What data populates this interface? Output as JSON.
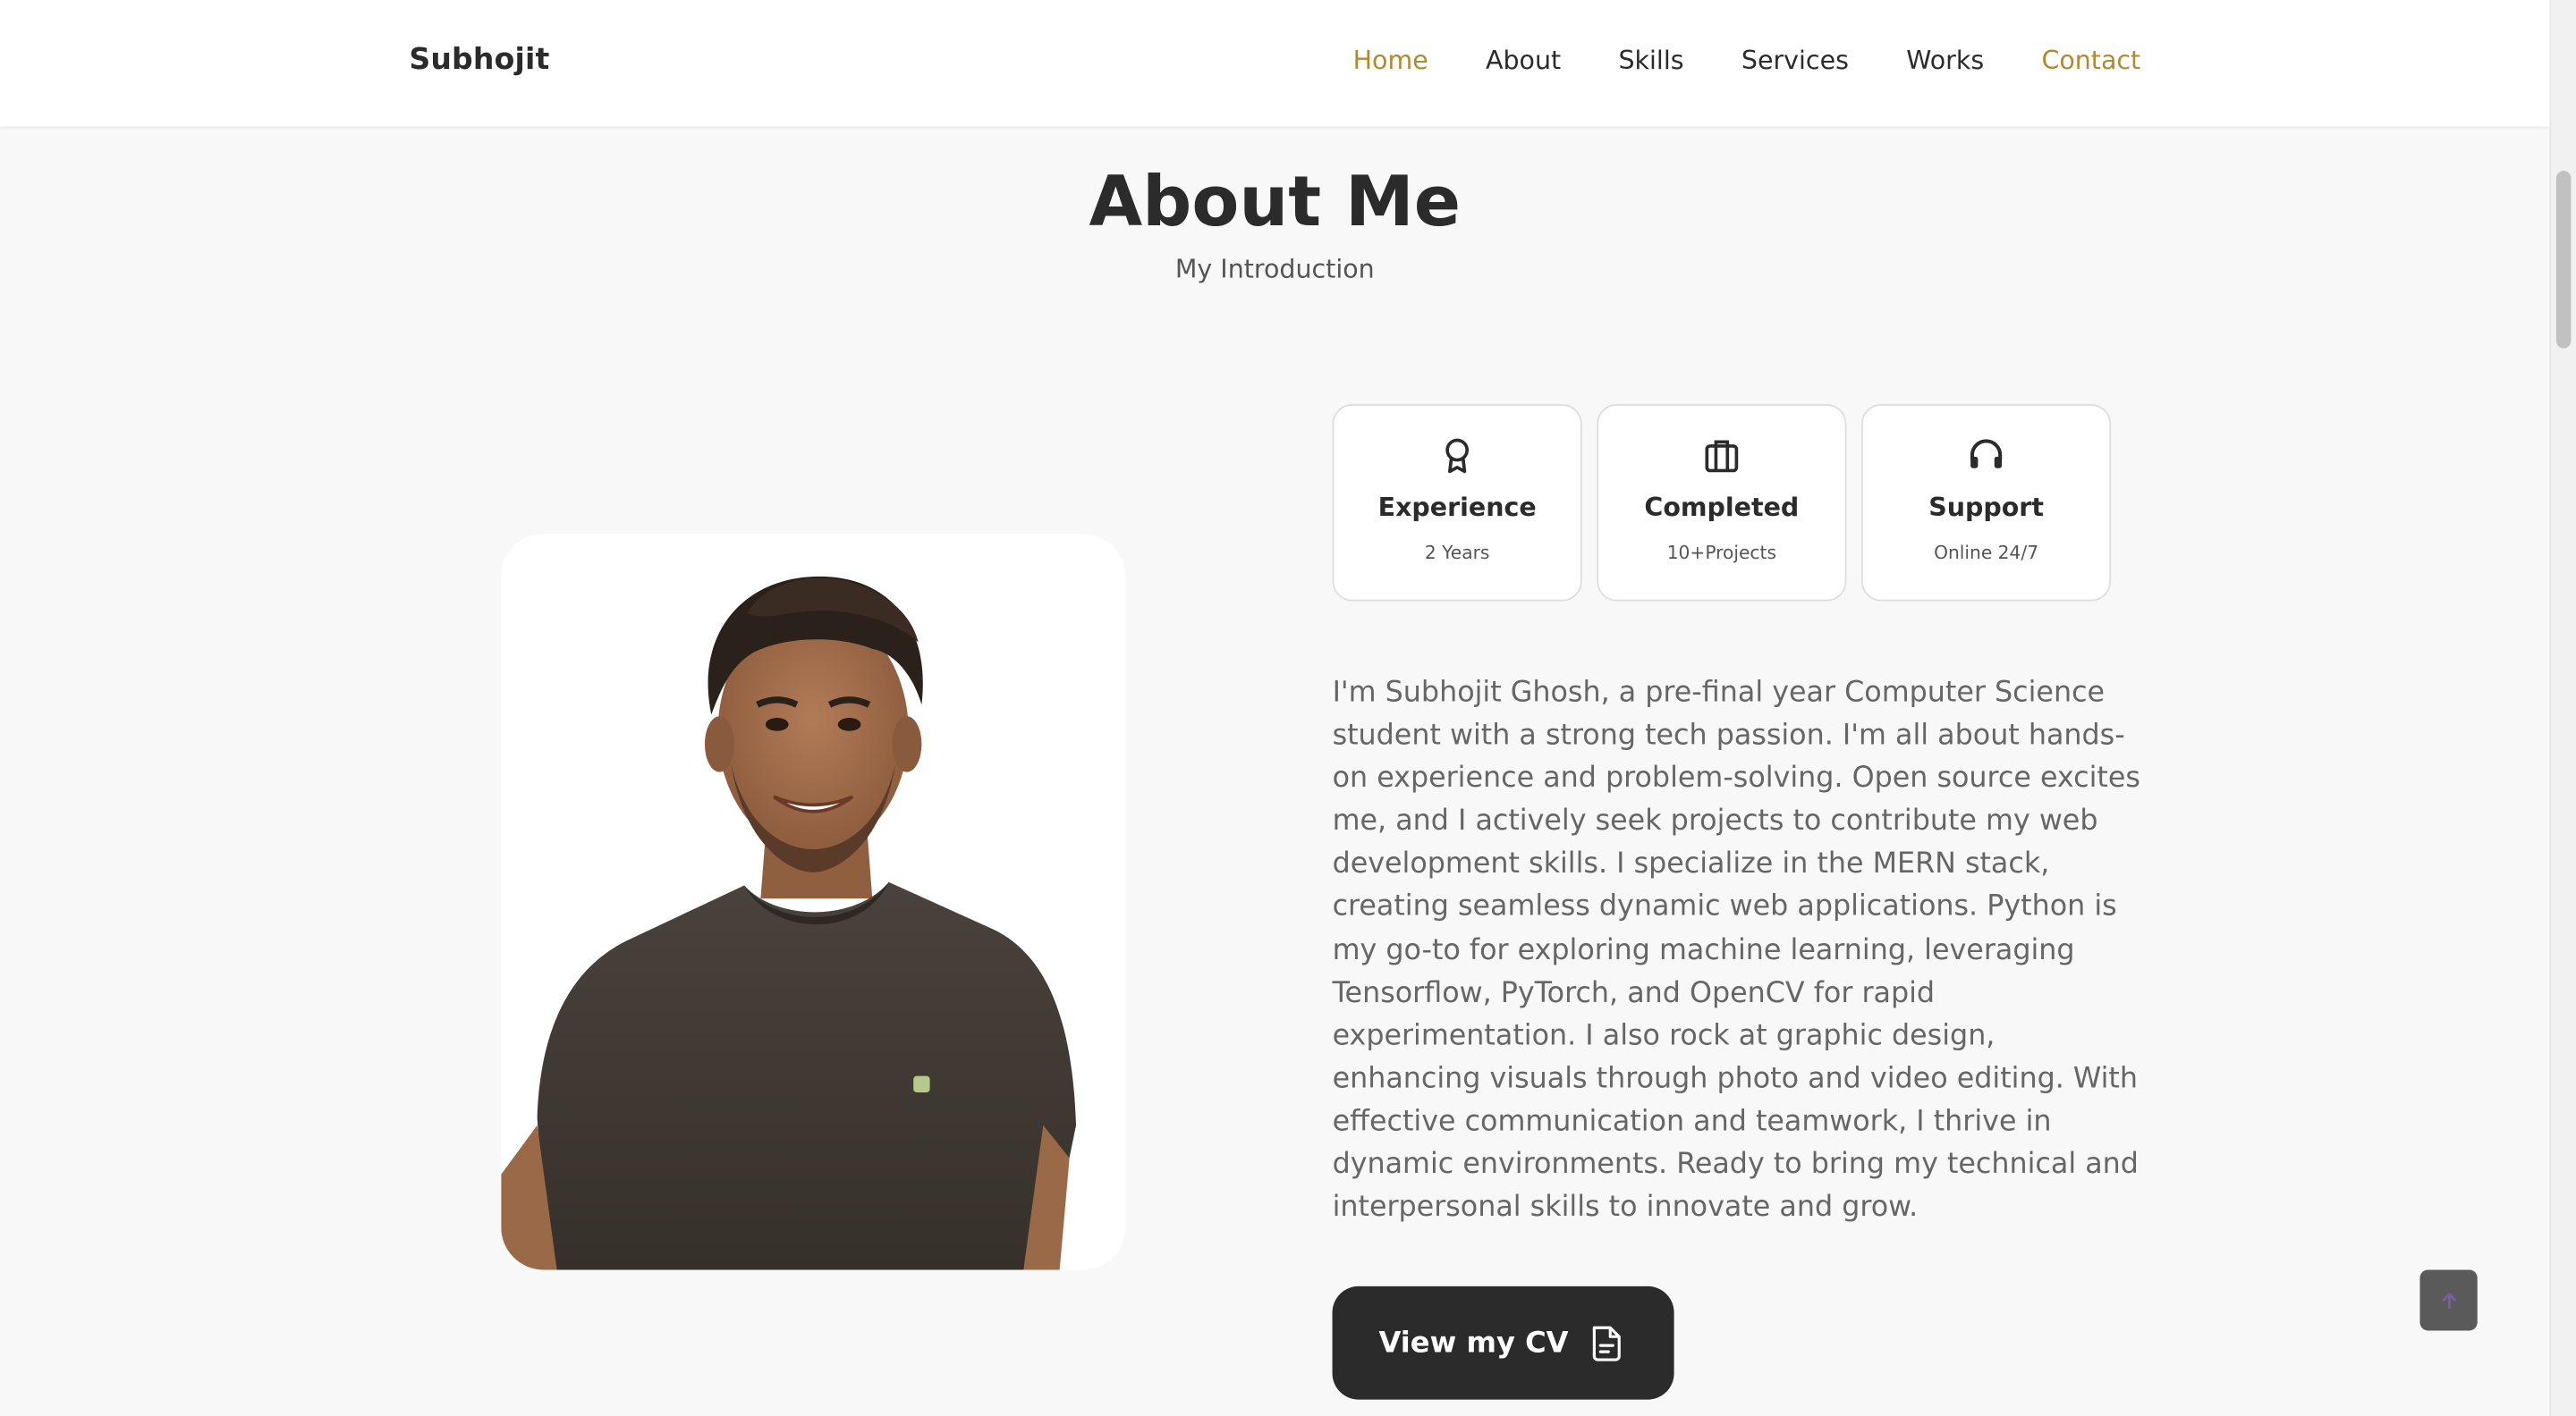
{
  "header": {
    "logo": "Subhojit",
    "nav": [
      {
        "label": "Home",
        "active": true
      },
      {
        "label": "About",
        "active": false
      },
      {
        "label": "Skills",
        "active": false
      },
      {
        "label": "Services",
        "active": false
      },
      {
        "label": "Works",
        "active": false
      },
      {
        "label": "Contact",
        "active": true
      }
    ]
  },
  "about": {
    "title": "About Me",
    "subtitle": "My Introduction",
    "cards": [
      {
        "icon": "award-icon",
        "title": "Experience",
        "subtitle": "2 Years"
      },
      {
        "icon": "briefcase-icon",
        "title": "Completed",
        "subtitle": "10+Projects"
      },
      {
        "icon": "headset-icon",
        "title": "Support",
        "subtitle": "Online 24/7"
      }
    ],
    "description": "I'm Subhojit Ghosh, a pre-final year Computer Science student with a strong tech passion. I'm all about hands-on experience and problem-solving. Open source excites me, and I actively seek projects to contribute my web development skills. I specialize in the MERN stack, creating seamless dynamic web applications. Python is my go-to for exploring machine learning, leveraging Tensorflow, PyTorch, and OpenCV for rapid experimentation. I also rock at graphic design, enhancing visuals through photo and video editing. With effective communication and teamwork, I thrive in dynamic environments. Ready to bring my technical and interpersonal skills to innovate and grow.",
    "cv_button": "View my CV",
    "cv_icon": "file-icon"
  },
  "scroll_up": {
    "icon": "arrow-up-icon"
  },
  "colors": {
    "accent": "#b08a2e",
    "text": "#2b2b2b",
    "muted": "#666666",
    "background": "#f8f8f8",
    "button": "#2b2b2b"
  }
}
